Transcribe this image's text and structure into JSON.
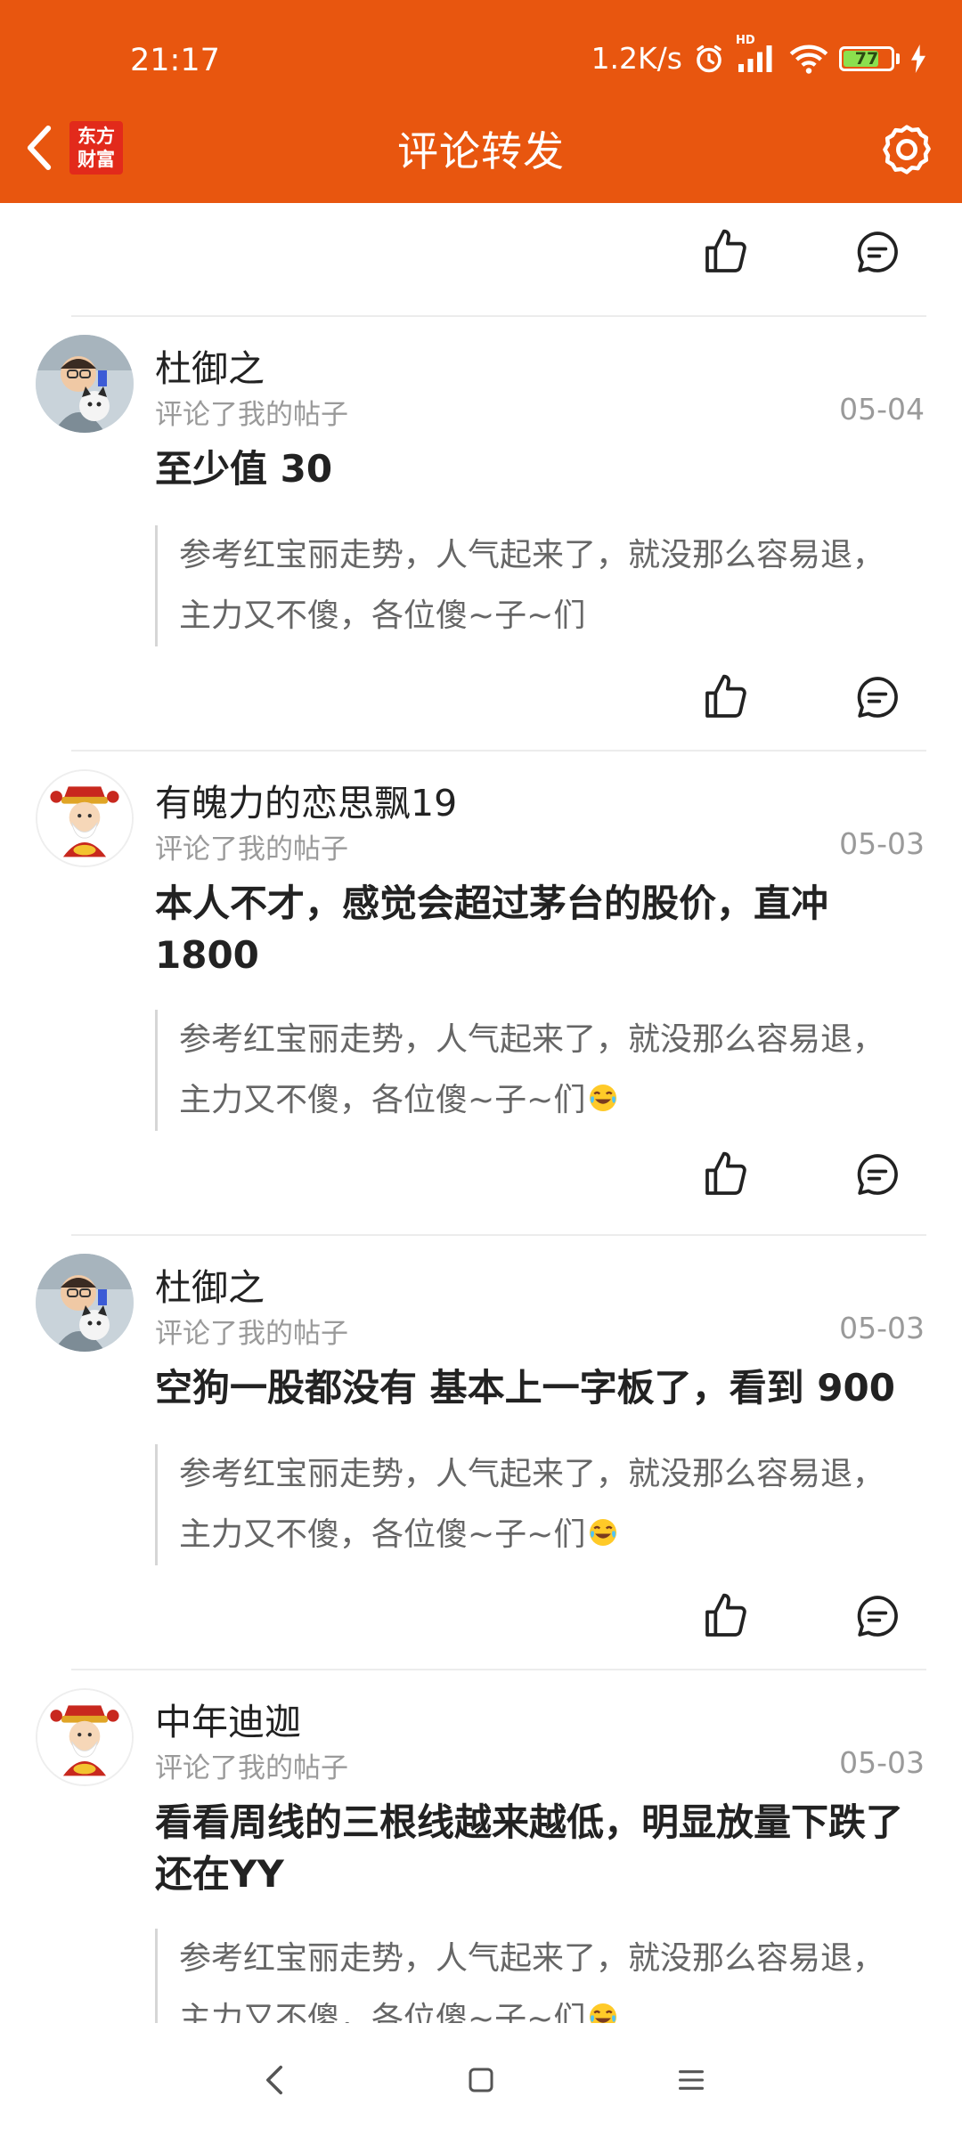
{
  "status_bar": {
    "time": "21:17",
    "network_speed": "1.2K/s",
    "hd_label": "HD",
    "battery_level": "77",
    "battery_fraction": 0.77
  },
  "nav": {
    "title": "评论转发",
    "logo_line1": "东方",
    "logo_line2": "财富"
  },
  "colors": {
    "brand_orange": "#E8560F",
    "logo_red": "#E22A1B"
  },
  "items": [
    {
      "user": "杜御之",
      "action": "评论了我的帖子",
      "date": "05-04",
      "comment": "至少值 30",
      "quote": "参考红宝丽走势，人气起来了，就没那么容易退，主力又不傻，各位傻~子~们",
      "avatar": "person-with-cat-avatar"
    },
    {
      "user": "有魄力的恋思飘19",
      "action": "评论了我的帖子",
      "date": "05-03",
      "comment": "本人不才，感觉会超过茅台的股价，直冲1800",
      "quote": "参考红宝丽走势，人气起来了，就没那么容易退，主力又不傻，各位傻~子~们",
      "avatar": "god-of-wealth-avatar"
    },
    {
      "user": "杜御之",
      "action": "评论了我的帖子",
      "date": "05-03",
      "comment": "空狗一股都没有 基本上一字板了，看到 900",
      "quote": "参考红宝丽走势，人气起来了，就没那么容易退，主力又不傻，各位傻~子~们",
      "avatar": "person-with-cat-avatar"
    },
    {
      "user": "中年迪迦",
      "action": "评论了我的帖子",
      "date": "05-03",
      "comment": "看看周线的三根线越来越低，明显放量下跌了还在YY",
      "quote": "参考红宝丽走势，人气起来了，就没那么容易退，主力又不傻，各位傻~子~们",
      "avatar": "god-of-wealth-avatar"
    }
  ],
  "icons": {
    "like": "thumbs-up-icon",
    "reply": "comment-bubble-icon",
    "emoji": "tears-of-joy-emoji",
    "settings": "gear-icon",
    "back": "chevron-left-icon"
  }
}
